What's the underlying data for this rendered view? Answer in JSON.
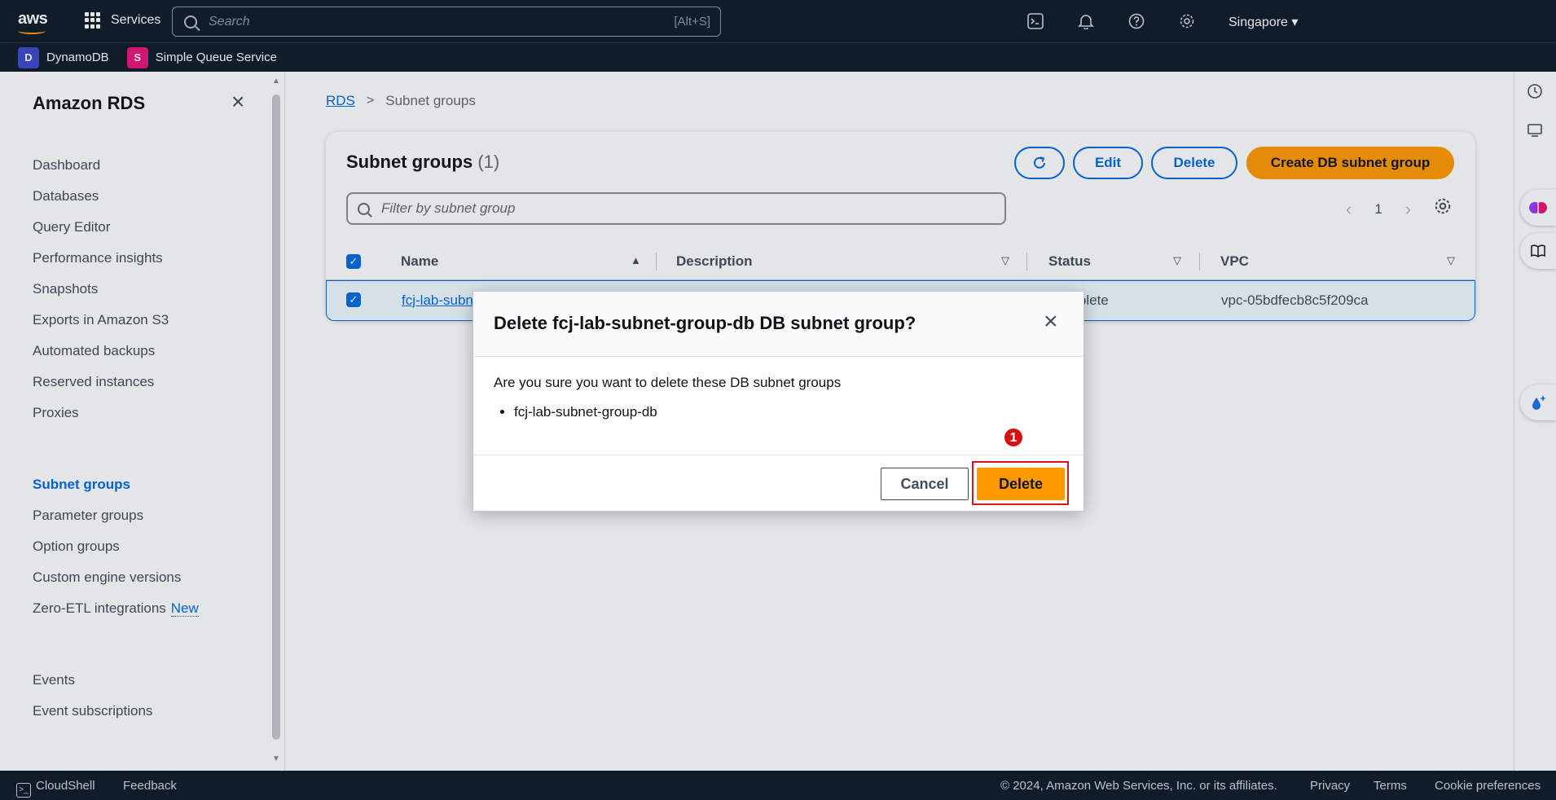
{
  "topnav": {
    "logo": "aws",
    "services_label": "Services",
    "search_placeholder": "Search",
    "search_shortcut": "[Alt+S]",
    "region": "Singapore"
  },
  "favorites": [
    {
      "label": "DynamoDB",
      "color": "#3b48cc"
    },
    {
      "label": "Simple Queue Service",
      "color": "#e7157b"
    }
  ],
  "sidebar": {
    "title": "Amazon RDS",
    "items": [
      {
        "label": "Dashboard"
      },
      {
        "label": "Databases"
      },
      {
        "label": "Query Editor"
      },
      {
        "label": "Performance insights"
      },
      {
        "label": "Snapshots"
      },
      {
        "label": "Exports in Amazon S3"
      },
      {
        "label": "Automated backups"
      },
      {
        "label": "Reserved instances"
      },
      {
        "label": "Proxies"
      },
      {
        "label": "Subnet groups"
      },
      {
        "label": "Parameter groups"
      },
      {
        "label": "Option groups"
      },
      {
        "label": "Custom engine versions"
      },
      {
        "label": "Zero-ETL integrations",
        "badge": "New"
      },
      {
        "label": "Events"
      },
      {
        "label": "Event subscriptions"
      }
    ]
  },
  "breadcrumb": {
    "root": "RDS",
    "current": "Subnet groups"
  },
  "main": {
    "title": "Subnet groups",
    "count": "(1)",
    "buttons": {
      "edit": "Edit",
      "delete": "Delete",
      "create": "Create DB subnet group"
    },
    "filter_placeholder": "Filter by subnet group",
    "page": "1",
    "columns": [
      "Name",
      "Description",
      "Status",
      "VPC"
    ],
    "rows": [
      {
        "name": "fcj-lab-subnet-group-db",
        "status": "Complete",
        "vpc": "vpc-05bdfecb8c5f209ca"
      }
    ]
  },
  "modal": {
    "title": "Delete fcj-lab-subnet-group-db DB subnet group?",
    "message": "Are you sure you want to delete these DB subnet groups",
    "items": [
      "fcj-lab-subnet-group-db"
    ],
    "cancel_label": "Cancel",
    "delete_label": "Delete",
    "step_number": "1"
  },
  "footer": {
    "cloudshell": "CloudShell",
    "feedback": "Feedback",
    "copyright": "© 2024, Amazon Web Services, Inc. or its affiliates.",
    "privacy": "Privacy",
    "terms": "Terms",
    "cookies": "Cookie preferences"
  },
  "colors": {
    "accent": "#006ce0",
    "primary_button": "#ff9900",
    "highlight": "#e0121b",
    "nav_bg": "#0f1b2a"
  }
}
